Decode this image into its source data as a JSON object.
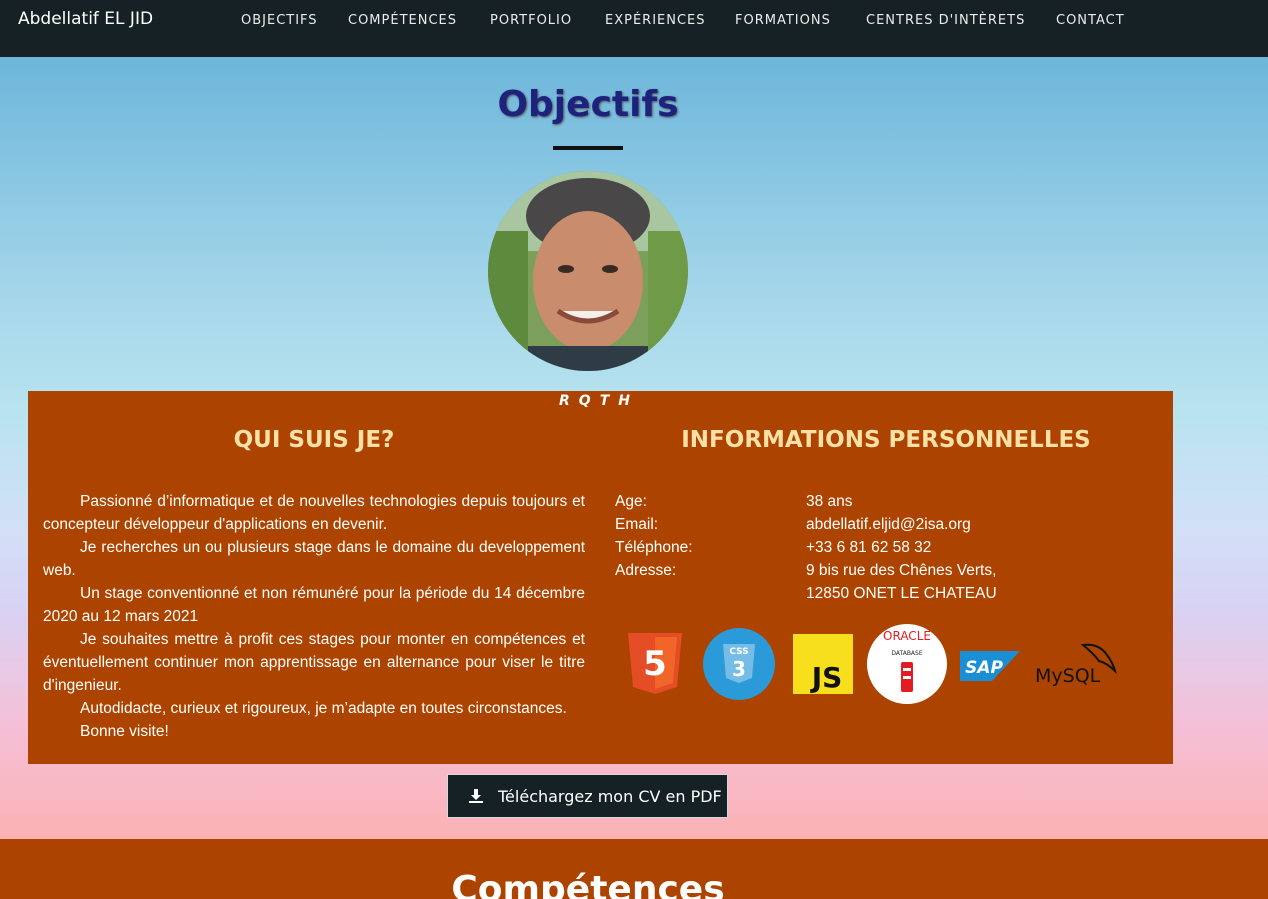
{
  "navbar": {
    "brand": "Abdellatif EL JID",
    "items": [
      "OBJECTIFS",
      "COMPÉTENCES",
      "PORTFOLIO",
      "EXPÉRIENCES",
      "FORMATIONS",
      "CENTRES D'INTÈRETS",
      "CONTACT"
    ],
    "background": "#152124"
  },
  "objectifs": {
    "title": "Objectifs",
    "badge": "RQTH",
    "about_title": "QUI SUIS JE?",
    "about_paragraphs": [
      "Passionné d’informatique et de nouvelles technologies depuis toujours et concepteur développeur d'applications en devenir.",
      "Je recherches un ou plusieurs stage dans le domaine du developpement web.",
      "Un stage conventionné et non rémunéré pour la période du 14 décembre 2020 au 12 mars 2021",
      "Je souhaites mettre à profit ces stages pour monter en compétences et éventuellement continuer mon apprentissage en alternance pour viser le titre d'ingenieur.",
      "Autodidacte, curieux et rigoureux, je m’adapte en toutes circonstances.",
      "Bonne visite!"
    ],
    "info_title": "INFORMATIONS PERSONNELLES",
    "info": [
      {
        "label": "Age:",
        "value": "38 ans"
      },
      {
        "label": "Email:",
        "value": "abdellatif.eljid@2isa.org"
      },
      {
        "label": "Téléphone:",
        "value": "+33 6 81 62 58 32"
      },
      {
        "label": "Adresse:",
        "value": "9 bis rue des Chênes Verts,"
      },
      {
        "label": "",
        "value": "12850 ONET LE CHATEAU"
      }
    ],
    "logos": {
      "html5": "5",
      "css3": "CSS",
      "js": "JS",
      "oracle": "ORACLE",
      "oracle_sub": "DATABASE",
      "sap": "SAP",
      "mysql": "MySQL"
    },
    "panel_color": "#ac4400",
    "title_color": "#1d237d"
  },
  "cv_button": {
    "label": "Téléchargez mon CV en PDF",
    "icon": "download-icon"
  },
  "competences": {
    "title": "Compétences"
  }
}
